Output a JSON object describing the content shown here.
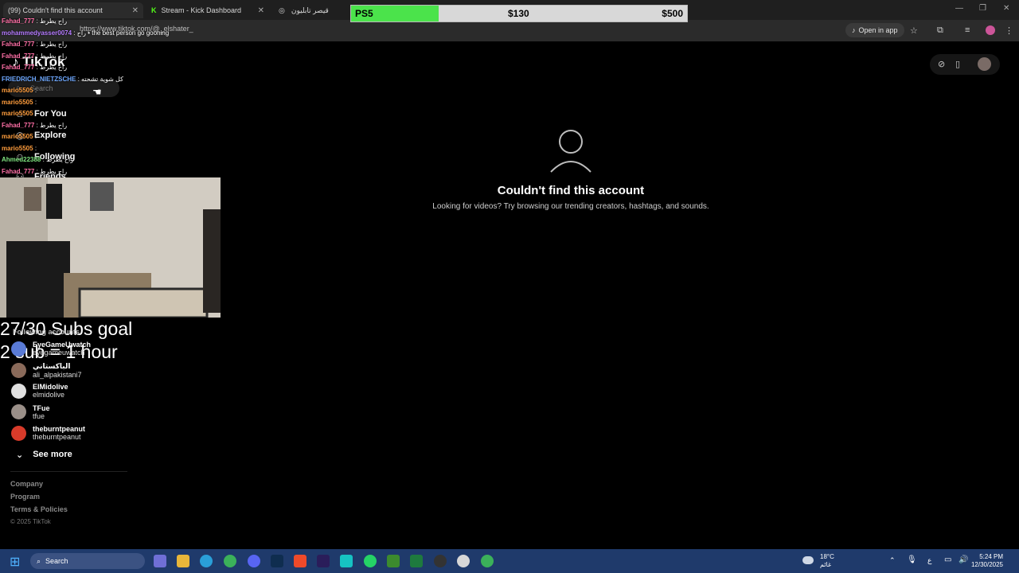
{
  "browser": {
    "tabs": [
      {
        "label": "(99) Couldn't find this account",
        "active": true
      },
      {
        "label": "Stream - Kick Dashboard",
        "active": false
      },
      {
        "label": "قيصر تابليون",
        "active": false
      }
    ],
    "url": "https://www.tiktok.com/@_elshater_",
    "open_in_app": "Open in app"
  },
  "overlay": {
    "ps5": {
      "label": "PS5",
      "current": "$130",
      "goal": "$500",
      "progress": 0.26
    },
    "subs_goal_line1": "27/30 Subs goal",
    "subs_goal_line2": "2 sub = 1 hour"
  },
  "chat": [
    {
      "name": "Fahad_777",
      "msg": "راح يطرط",
      "color": "#ff6fa6"
    },
    {
      "name": "mohammedyasser0074",
      "msg": "راح • the best person go gooning",
      "color": "#b57bff"
    },
    {
      "name": "Fahad_777",
      "msg": "راح يطرط",
      "color": "#ff6fa6"
    },
    {
      "name": "Fahad_777",
      "msg": "راح يطرط",
      "color": "#ff6fa6"
    },
    {
      "name": "Fahad_777",
      "msg": "راح يطرط",
      "color": "#ff6fa6"
    },
    {
      "name": "FRIEDRICH_NIETZSCHE",
      "msg": "كل شوية تشحته",
      "color": "#6ea8ff"
    },
    {
      "name": "mario5505",
      "msg": "",
      "color": "#ff9d3d"
    },
    {
      "name": "mario5505",
      "msg": "",
      "color": "#ff9d3d"
    },
    {
      "name": "mario5505",
      "msg": "",
      "color": "#ff9d3d"
    },
    {
      "name": "Fahad_777",
      "msg": "راح يطرط",
      "color": "#ff6fa6"
    },
    {
      "name": "mario5505",
      "msg": "",
      "color": "#ff9d3d"
    },
    {
      "name": "mario5505",
      "msg": "",
      "color": "#ff9d3d"
    },
    {
      "name": "Ahmed22388",
      "msg": "راح يطرط",
      "color": "#7fe37f"
    },
    {
      "name": "Fahad_777",
      "msg": "راح يطرط",
      "color": "#ff6fa6"
    }
  ],
  "tiktok": {
    "logo": "TikTok",
    "search_placeholder": "Search",
    "nav": [
      "For You",
      "Explore",
      "Following",
      "Friends"
    ],
    "following_header": "Following accounts",
    "accounts": [
      {
        "name": "EyeGameUwatch",
        "handle": "eyegameuwatch",
        "color": "#5a7bd6"
      },
      {
        "name": "الباكستاني",
        "handle": "ali_alpakistani7",
        "color": "#8a6a5a"
      },
      {
        "name": "ElMidolive",
        "handle": "elmidolive",
        "color": "#e0e0e0"
      },
      {
        "name": "TFue",
        "handle": "tfue",
        "color": "#9a8f88"
      },
      {
        "name": "theburntpeanut",
        "handle": "theburntpeanut",
        "color": "#d83b2a"
      }
    ],
    "see_more": "See more",
    "footer": [
      "Company",
      "Program",
      "Terms & Policies"
    ],
    "copyright": "© 2025 TikTok",
    "not_found_title": "Couldn't find this account",
    "not_found_sub": "Looking for videos? Try browsing our trending creators, hashtags, and sounds."
  },
  "taskbar": {
    "search": "Search",
    "weather_temp": "18°C",
    "weather_desc": "غائم",
    "lang": "ع",
    "time": "5:24 PM",
    "date": "12/30/2025"
  }
}
